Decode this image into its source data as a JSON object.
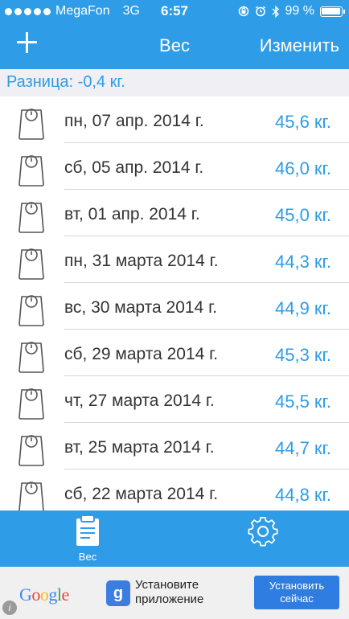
{
  "status_bar": {
    "carrier": "MegaFon",
    "network": "3G",
    "time": "6:57",
    "battery": "99 %",
    "battery_level": 0.99,
    "icons": [
      "rotation-lock-icon",
      "alarm-icon",
      "bluetooth-icon"
    ]
  },
  "nav": {
    "add_icon": "plus-icon",
    "title": "Вес",
    "edit_label": "Изменить"
  },
  "summary": {
    "difference": "Разница: -0,4 кг."
  },
  "entries": [
    {
      "date": "пн, 07 апр. 2014 г.",
      "weight": "45,6 кг."
    },
    {
      "date": "сб, 05 апр. 2014 г.",
      "weight": "46,0 кг."
    },
    {
      "date": "вт, 01 апр. 2014 г.",
      "weight": "45,0 кг."
    },
    {
      "date": "пн, 31 марта 2014 г.",
      "weight": "44,3 кг."
    },
    {
      "date": "вс, 30 марта 2014 г.",
      "weight": "44,9 кг."
    },
    {
      "date": "сб, 29 марта 2014 г.",
      "weight": "45,3 кг."
    },
    {
      "date": "чт, 27 марта 2014 г.",
      "weight": "45,5 кг."
    },
    {
      "date": "вт, 25 марта 2014 г.",
      "weight": "44,7 кг."
    },
    {
      "date": "сб, 22 марта 2014 г.",
      "weight": "44,8 кг."
    }
  ],
  "entry_icon": "scale-icon",
  "tabbar": {
    "weight_tab": {
      "label": "Вес",
      "icon": "clipboard-icon"
    },
    "settings_tab": {
      "icon": "gear-icon"
    }
  },
  "ad": {
    "brand": "Google",
    "text_line1": "Установите",
    "text_line2": "приложение",
    "button_line1": "Установить",
    "button_line2": "сейчас",
    "info": "i",
    "colors": {
      "g_blue": "#4285f4",
      "g_red": "#ea4335",
      "g_yellow": "#fbbc05",
      "g_green": "#34a853"
    }
  },
  "colors": {
    "accent": "#2e9ce6",
    "background": "#efeff4"
  }
}
